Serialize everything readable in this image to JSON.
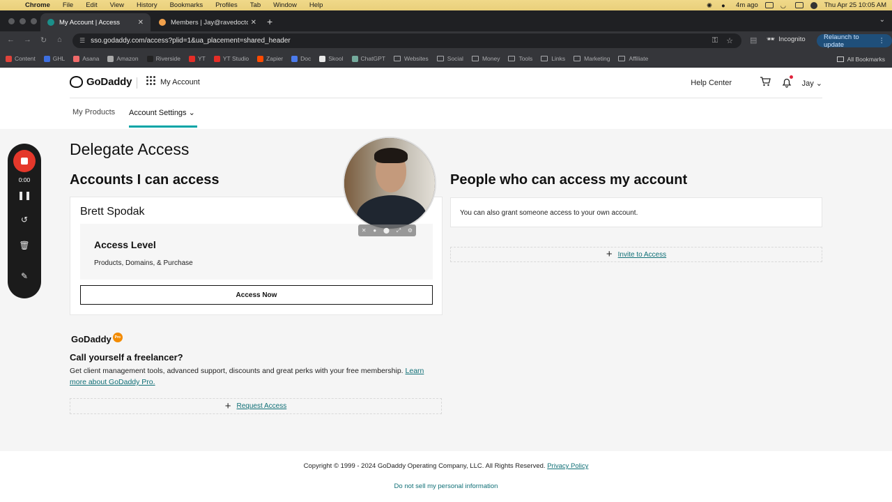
{
  "menubar": {
    "app": "Chrome",
    "items": [
      "File",
      "Edit",
      "View",
      "History",
      "Bookmarks",
      "Profiles",
      "Tab",
      "Window",
      "Help"
    ],
    "status_time_ago": "4m ago",
    "clock": "Thu Apr 25  10:05 AM"
  },
  "tabs": [
    {
      "title": "My Account | Access",
      "active": true
    },
    {
      "title": "Members | Jay@ravedoctor.c",
      "active": false
    }
  ],
  "address_bar": {
    "url": "sso.godaddy.com/access?plid=1&ua_placement=shared_header",
    "incognito_label": "Incognito",
    "relaunch_label": "Relaunch to update"
  },
  "bookmarks": {
    "items": [
      {
        "label": "Content",
        "type": "site",
        "color": "#e0433b"
      },
      {
        "label": "GHL",
        "type": "site",
        "color": "#3d6fe0"
      },
      {
        "label": "Asana",
        "type": "site",
        "color": "#f06a6a"
      },
      {
        "label": "Amazon",
        "type": "site",
        "color": "#aaaaaa"
      },
      {
        "label": "Riverside",
        "type": "site",
        "color": "#222222"
      },
      {
        "label": "YT",
        "type": "site",
        "color": "#e52d27"
      },
      {
        "label": "YT Studio",
        "type": "site",
        "color": "#e52d27"
      },
      {
        "label": "Zapier",
        "type": "site",
        "color": "#ff4a00"
      },
      {
        "label": "Doc",
        "type": "site",
        "color": "#4b7bec"
      },
      {
        "label": "Skool",
        "type": "site",
        "color": "#e8e8e8"
      },
      {
        "label": "ChatGPT",
        "type": "site",
        "color": "#74aa9c"
      },
      {
        "label": "Websites",
        "type": "folder"
      },
      {
        "label": "Social",
        "type": "folder"
      },
      {
        "label": "Money",
        "type": "folder"
      },
      {
        "label": "Tools",
        "type": "folder"
      },
      {
        "label": "Links",
        "type": "folder"
      },
      {
        "label": "Marketing",
        "type": "folder"
      },
      {
        "label": "Affiliate",
        "type": "folder"
      }
    ],
    "all_bookmarks": "All Bookmarks"
  },
  "header": {
    "logo": "GoDaddy",
    "my_account": "My Account",
    "help_center": "Help Center",
    "user": "Jay ⌄"
  },
  "subnav": {
    "my_products": "My Products",
    "account_settings": "Account Settings ⌄"
  },
  "main": {
    "title": "Delegate Access",
    "left_heading": "Accounts I can access",
    "right_heading": "People who can access my account",
    "account_card": {
      "name": "Brett Spodak",
      "access_level_title": "Access Level",
      "access_level_desc": "Products, Domains, & Purchase",
      "access_button": "Access Now"
    },
    "right_card_text": "You can also grant someone access to your own account.",
    "invite_label": "Invite to Access",
    "pro": {
      "logo": "GoDaddy",
      "badge": "Pro",
      "heading": "Call yourself a freelancer?",
      "body": "Get client management tools, advanced support, discounts and great perks with your free membership. ",
      "link": "Learn more about GoDaddy Pro.",
      "request_label": "Request Access"
    }
  },
  "footer": {
    "copyright": "Copyright © 1999 - 2024 GoDaddy Operating Company, LLC. All Rights Reserved. ",
    "privacy": "Privacy Policy",
    "do_not_sell": "Do not sell my personal information"
  },
  "recorder": {
    "time": "0:00"
  },
  "colors": {
    "accent": "#00a4a6",
    "link": "#0f6f76",
    "record": "#e5382b"
  }
}
